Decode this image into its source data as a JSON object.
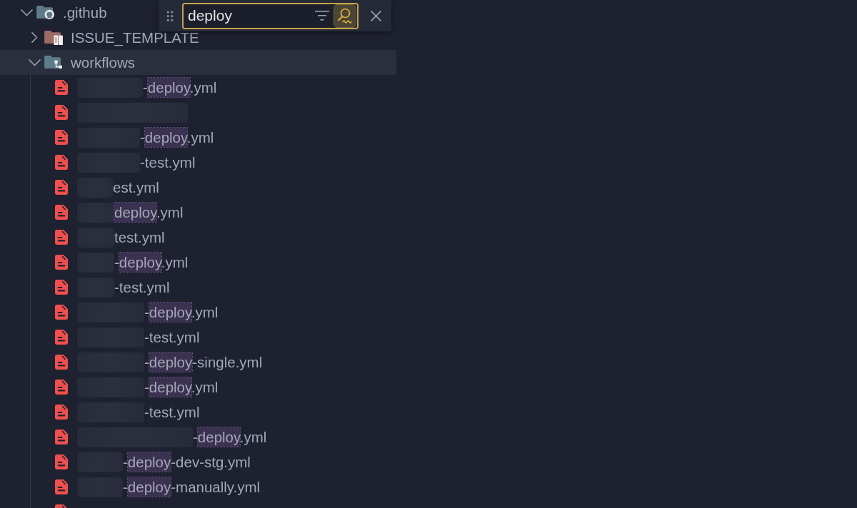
{
  "find_widget": {
    "value": "deploy",
    "filter": false,
    "fuzzy_match": true
  },
  "tree": [
    {
      "kind": "github",
      "label": ".github",
      "expanded": true,
      "selected": false,
      "children": [
        {
          "kind": "template",
          "label": "ISSUE_TEMPLATE",
          "expanded": false,
          "selected": false
        },
        {
          "kind": "workflow",
          "label": "workflows",
          "expanded": true,
          "selected": true,
          "children": [
            {
              "kind": "yaml",
              "selected": false,
              "redacted": true,
              "name": [
                {
                  "text": "-",
                  "match": false
                },
                {
                  "text": "deploy",
                  "match": true
                },
                {
                  "text": ".yml",
                  "match": false
                }
              ]
            },
            {
              "kind": "yaml",
              "selected": false,
              "redacted": true
            },
            {
              "kind": "yaml",
              "selected": false,
              "redacted": true,
              "name": [
                {
                  "text": "-",
                  "match": false
                },
                {
                  "text": "deploy",
                  "match": true
                },
                {
                  "text": ".yml",
                  "match": false
                }
              ]
            },
            {
              "kind": "yaml",
              "selected": false,
              "redacted": true,
              "name": [
                {
                  "text": "-test.yml",
                  "match": false
                }
              ]
            },
            {
              "kind": "yaml",
              "selected": false,
              "redacted": true,
              "name": [
                {
                  "text": "est.yml",
                  "match": false
                }
              ]
            },
            {
              "kind": "yaml",
              "selected": false,
              "redacted": true,
              "name": [
                {
                  "text": "deploy",
                  "match": true
                },
                {
                  "text": ".yml",
                  "match": false
                }
              ]
            },
            {
              "kind": "yaml",
              "selected": false,
              "redacted": true,
              "name": [
                {
                  "text": "test.yml",
                  "match": false
                }
              ]
            },
            {
              "kind": "yaml",
              "selected": false,
              "redacted": true,
              "name": [
                {
                  "text": "-",
                  "match": false
                },
                {
                  "text": "deploy",
                  "match": true
                },
                {
                  "text": ".yml",
                  "match": false
                }
              ]
            },
            {
              "kind": "yaml",
              "selected": false,
              "redacted": true,
              "name": [
                {
                  "text": "-test.yml",
                  "match": false
                }
              ]
            },
            {
              "kind": "yaml",
              "selected": false,
              "redacted": true,
              "name": [
                {
                  "text": "-",
                  "match": false
                },
                {
                  "text": "deploy",
                  "match": true
                },
                {
                  "text": ".yml",
                  "match": false
                }
              ]
            },
            {
              "kind": "yaml",
              "selected": false,
              "redacted": true,
              "name": [
                {
                  "text": "-test.yml",
                  "match": false
                }
              ]
            },
            {
              "kind": "yaml",
              "selected": false,
              "redacted": true,
              "name": [
                {
                  "text": "-",
                  "match": false
                },
                {
                  "text": "deploy",
                  "match": true
                },
                {
                  "text": "-single.yml",
                  "match": false
                }
              ]
            },
            {
              "kind": "yaml",
              "selected": false,
              "redacted": true,
              "name": [
                {
                  "text": "-",
                  "match": false
                },
                {
                  "text": "deploy",
                  "match": true
                },
                {
                  "text": ".yml",
                  "match": false
                }
              ]
            },
            {
              "kind": "yaml",
              "selected": false,
              "redacted": true,
              "name": [
                {
                  "text": "-test.yml",
                  "match": false
                }
              ]
            },
            {
              "kind": "yaml",
              "selected": false,
              "redacted": true,
              "name": [
                {
                  "text": "-",
                  "match": false
                },
                {
                  "text": "deploy",
                  "match": true
                },
                {
                  "text": ".yml",
                  "match": false
                }
              ]
            },
            {
              "kind": "yaml",
              "selected": false,
              "redacted": true,
              "name": [
                {
                  "text": "-",
                  "match": false
                },
                {
                  "text": "deploy",
                  "match": true
                },
                {
                  "text": "-dev-stg.yml",
                  "match": false
                }
              ]
            },
            {
              "kind": "yaml",
              "selected": false,
              "redacted": true,
              "name": [
                {
                  "text": "-",
                  "match": false
                },
                {
                  "text": "deploy",
                  "match": true
                },
                {
                  "text": "-manually.yml",
                  "match": false
                }
              ]
            },
            {
              "kind": "yaml",
              "selected": false,
              "redacted": false
            }
          ]
        }
      ]
    }
  ]
}
